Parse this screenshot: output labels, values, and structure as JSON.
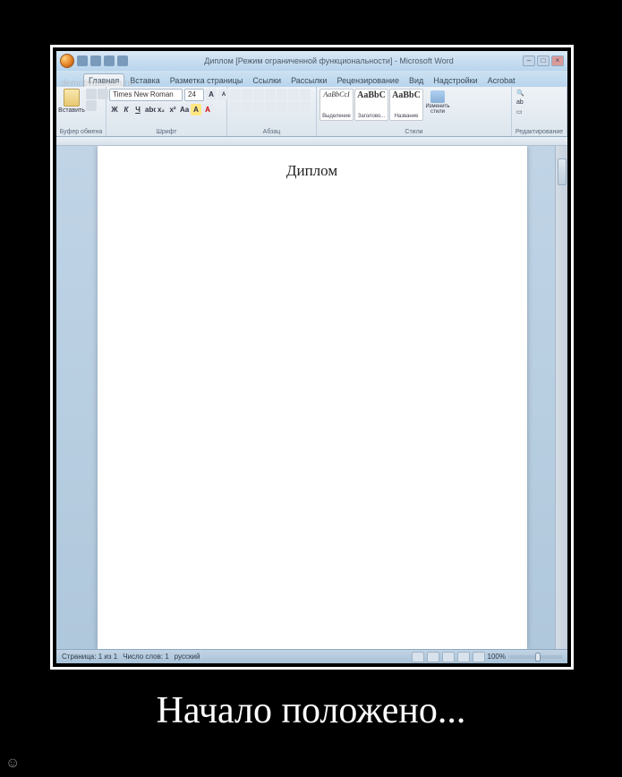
{
  "poster": {
    "caption": "Начало положено...",
    "watermark": "demotivatorium.ru"
  },
  "window": {
    "title": "Диплом [Режим ограниченной функциональности] - Microsoft Word",
    "controls": {
      "minimize": "–",
      "maximize": "□",
      "close": "×"
    }
  },
  "tabs": {
    "home": "Главная",
    "insert": "Вставка",
    "layout": "Разметка страницы",
    "refs": "Ссылки",
    "mail": "Рассылки",
    "review": "Рецензирование",
    "view": "Вид",
    "addins": "Надстройки",
    "acrobat": "Acrobat"
  },
  "ribbon": {
    "clipboard": {
      "paste": "Вставить",
      "group": "Буфер обмена"
    },
    "font": {
      "name": "Times New Roman",
      "size": "24",
      "group": "Шрифт",
      "bold": "Ж",
      "italic": "К",
      "underline": "Ч"
    },
    "paragraph": {
      "group": "Абзац"
    },
    "styles": {
      "s1": {
        "preview": "AaBbCcI",
        "name": "Выделение"
      },
      "s2": {
        "preview": "AaBbC",
        "name": "Заголово..."
      },
      "s3": {
        "preview": "AaBbC",
        "name": "Название"
      },
      "change": "Изменить стили",
      "group": "Стили"
    },
    "editing": {
      "group": "Редактирование"
    }
  },
  "document": {
    "heading": "Диплом"
  },
  "statusbar": {
    "page": "Страница: 1 из 1",
    "words": "Число слов: 1",
    "lang": "русский",
    "zoom": "100%"
  }
}
